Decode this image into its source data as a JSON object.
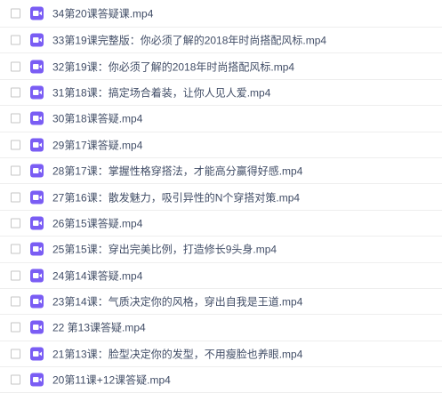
{
  "files": [
    {
      "name": "34第20课答疑课.mp4",
      "icon": "video-file-icon"
    },
    {
      "name": "33第19课完整版：你必须了解的2018年时尚搭配风标.mp4",
      "icon": "video-file-icon"
    },
    {
      "name": "32第19课：你必须了解的2018年时尚搭配风标.mp4",
      "icon": "video-file-icon"
    },
    {
      "name": "31第18课：搞定场合着装，让你人见人爱.mp4",
      "icon": "video-file-icon"
    },
    {
      "name": "30第18课答疑.mp4",
      "icon": "video-file-icon"
    },
    {
      "name": "29第17课答疑.mp4",
      "icon": "video-file-icon"
    },
    {
      "name": "28第17课：掌握性格穿搭法，才能高分赢得好感.mp4",
      "icon": "video-file-icon"
    },
    {
      "name": "27第16课：散发魅力，吸引异性的N个穿搭对策.mp4",
      "icon": "video-file-icon"
    },
    {
      "name": "26第15课答疑.mp4",
      "icon": "video-file-icon"
    },
    {
      "name": "25第15课：穿出完美比例，打造修长9头身.mp4",
      "icon": "video-file-icon"
    },
    {
      "name": "24第14课答疑.mp4",
      "icon": "video-file-icon"
    },
    {
      "name": "23第14课：气质决定你的风格，穿出自我是王道.mp4",
      "icon": "video-file-icon"
    },
    {
      "name": "22 第13课答疑.mp4",
      "icon": "video-file-icon"
    },
    {
      "name": "21第13课：脸型决定你的发型，不用瘦脸也养眼.mp4",
      "icon": "video-file-icon"
    },
    {
      "name": "20第11课+12课答疑.mp4",
      "icon": "video-file-icon"
    }
  ],
  "colors": {
    "icon_bg": "#7a5df4",
    "text": "#424e67",
    "row_border": "#eeeeee"
  }
}
